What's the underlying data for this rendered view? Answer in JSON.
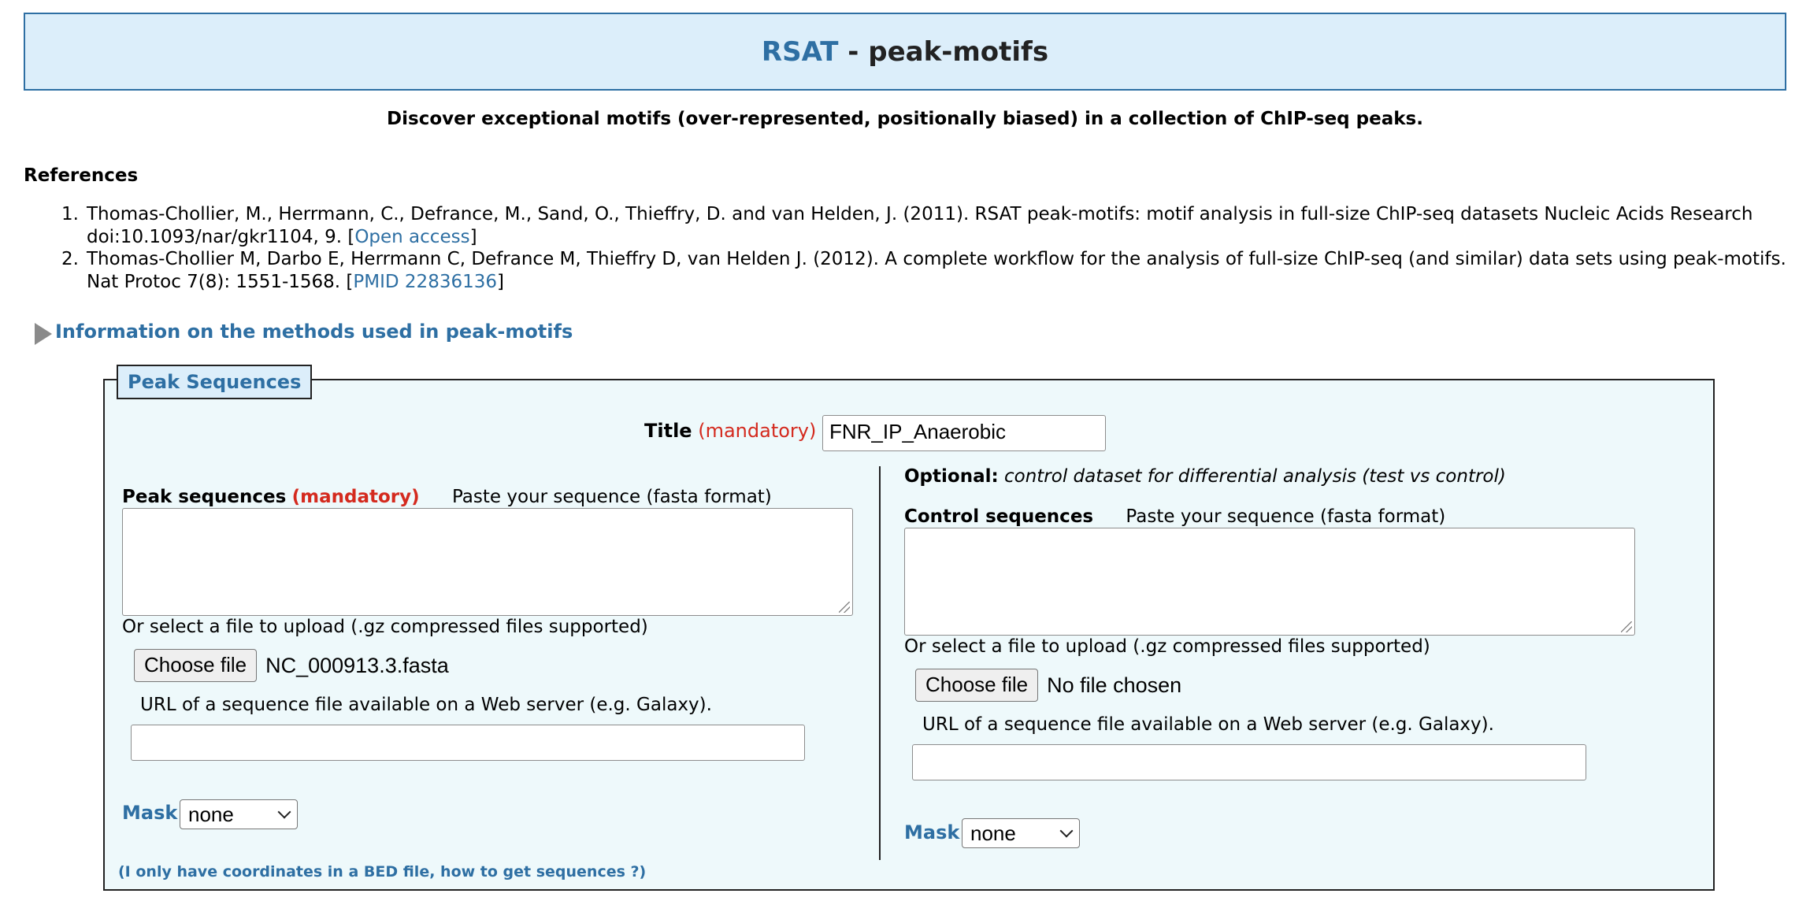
{
  "header": {
    "brand": "RSAT",
    "separator": " - ",
    "tool": "peak-motifs"
  },
  "subtitle": "Discover exceptional motifs (over-represented, positionally biased) in a collection of ChIP-seq peaks.",
  "references": {
    "heading": "References",
    "items": [
      {
        "num": "1.",
        "text": "Thomas-Chollier, M., Herrmann, C., Defrance, M., Sand, O., Thieffry, D. and van Helden, J. (2011). RSAT peak-motifs: motif analysis in full-size ChIP-seq datasets Nucleic Acids Research doi:10.1093/nar/gkr1104, 9. [",
        "link": "Open access",
        "close": "]"
      },
      {
        "num": "2.",
        "text": "Thomas-Chollier M, Darbo E, Herrmann C, Defrance M, Thieffry D, van Helden J. (2012). A complete workflow for the analysis of full-size ChIP-seq (and similar) data sets using peak-motifs. Nat Protoc 7(8): 1551-1568. [",
        "link": "PMID 22836136",
        "close": "]"
      }
    ]
  },
  "info_toggle": "Information on the methods used in peak-motifs",
  "peak_section": {
    "legend": "Peak Sequences",
    "title_label": "Title",
    "title_mandatory": "(mandatory)",
    "title_value": "FNR_IP_Anaerobic",
    "left": {
      "label": "Peak sequences",
      "mandatory": "(mandatory)",
      "hint": "Paste your sequence (fasta format)",
      "upload_label": "Or select a file to upload (.gz compressed files supported)",
      "choose_file": "Choose file",
      "file_name": "NC_000913.3.fasta",
      "url_label": "URL of a sequence file available on a Web server (e.g. Galaxy).",
      "url_value": "",
      "mask_label": "Mask",
      "mask_value": "none"
    },
    "right": {
      "optional_label": "Optional:",
      "optional_desc": "control dataset for differential analysis (test vs control)",
      "label": "Control sequences",
      "hint": "Paste your sequence (fasta format)",
      "upload_label": "Or select a file to upload (.gz compressed files supported)",
      "choose_file": "Choose file",
      "file_name": "No file chosen",
      "url_label": "URL of a sequence file available on a Web server (e.g. Galaxy).",
      "url_value": "",
      "mask_label": "Mask",
      "mask_value": "none"
    },
    "bed_link": "(I only have coordinates in a BED file, how to get sequences ?)"
  },
  "colors": {
    "link": "#2e6fa3",
    "mandatory": "#d42a1e",
    "banner_bg": "#dceefa",
    "box_bg": "#eef9fb"
  }
}
